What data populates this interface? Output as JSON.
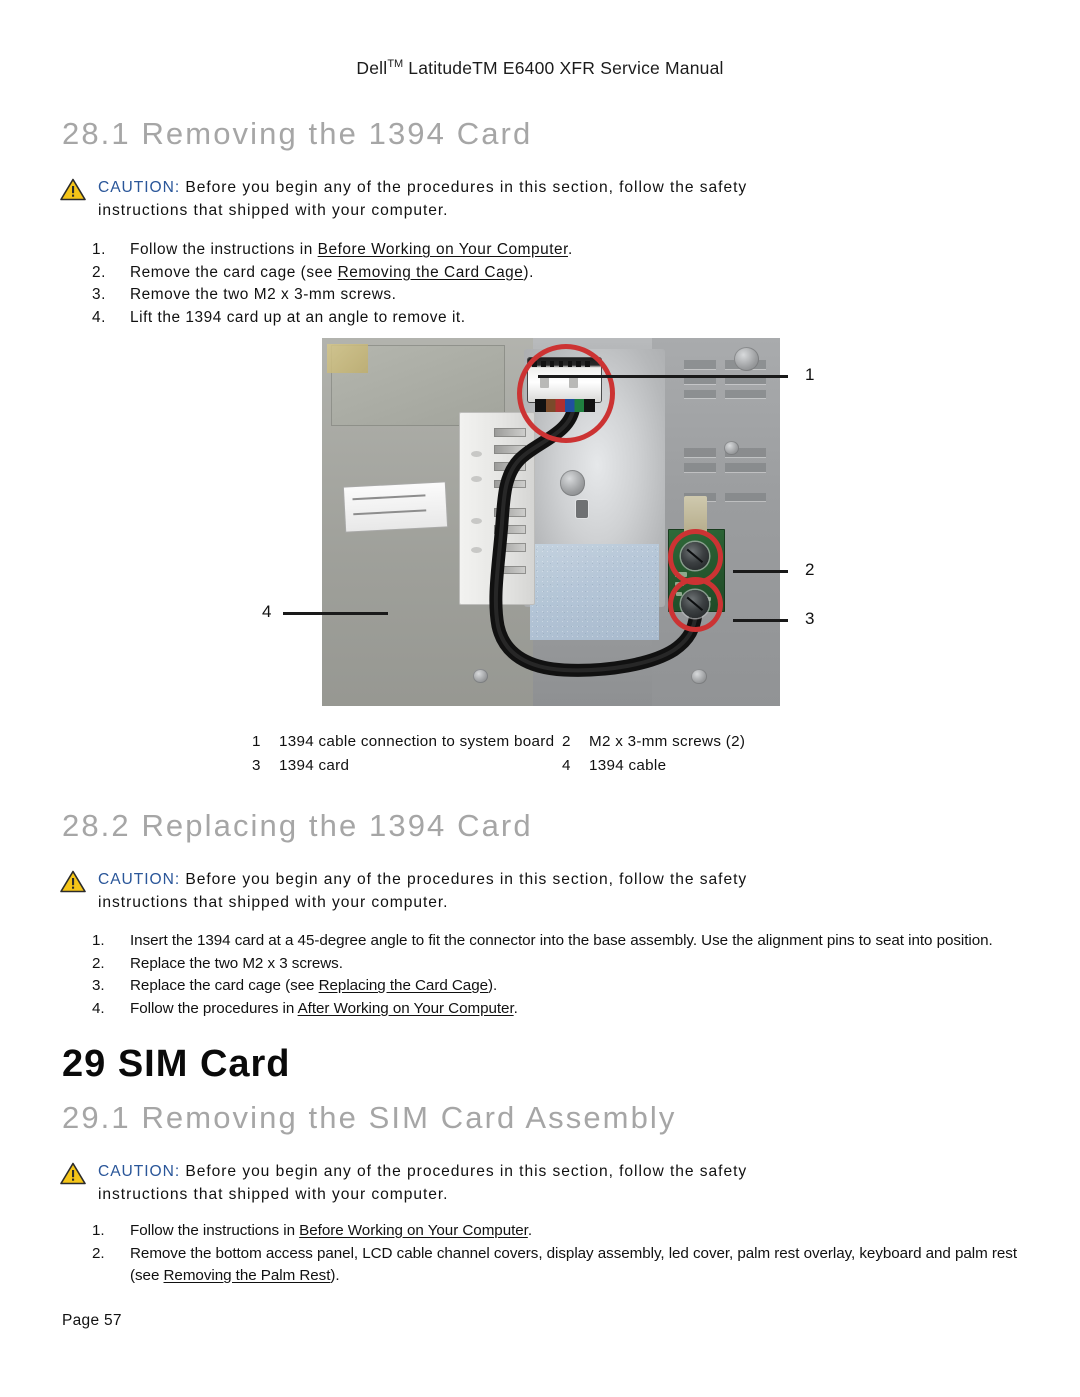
{
  "document": {
    "header_prefix": "Dell",
    "header_tm1": "TM",
    "header_middle": " Latitude",
    "header_tm2": "TM",
    "header_suffix": " E6400 XFR Service Manual",
    "footer": "Page 57"
  },
  "colors": {
    "heading_gray": "#a6a6a6",
    "caution_blue": "#2a5699",
    "warning_yellow": "#f5c518",
    "highlight_red": "#cc3333",
    "body_black": "#111111"
  },
  "caution": {
    "label": "CAUTION:",
    "line1": " Before you begin any of the procedures in this section, follow the safety",
    "line2": "instructions that shipped with your computer.",
    "icon": "warning-triangle-icon"
  },
  "sections": {
    "s28_1": {
      "heading": "28.1  Removing the 1394 Card",
      "steps": [
        {
          "n": "1.",
          "pre": "Follow the instructions in ",
          "link": "Before Working on Your Computer",
          "post": "."
        },
        {
          "n": "2.",
          "pre": "Remove the card cage (see ",
          "link": "Removing the Card Cage",
          "post": ")."
        },
        {
          "n": "3.",
          "pre": "Remove the two M2 x 3-mm screws.",
          "link": "",
          "post": ""
        },
        {
          "n": "4.",
          "pre": "Lift the 1394 card up at an angle to remove it.",
          "link": "",
          "post": ""
        }
      ]
    },
    "s28_2": {
      "heading": "28.2  Replacing the 1394 Card",
      "steps": [
        {
          "n": "1.",
          "pre": "Insert the 1394 card at a 45-degree angle to fit the connector into the base assembly. Use the alignment pins to seat into position.",
          "link": "",
          "post": ""
        },
        {
          "n": "2.",
          "pre": "Replace the two M2 x 3 screws.",
          "link": "",
          "post": ""
        },
        {
          "n": "3.",
          "pre": "Replace the card cage (see ",
          "link": "Replacing the Card Cage",
          "post": ")."
        },
        {
          "n": "4.",
          "pre": "Follow the procedures in ",
          "link": "After Working on Your Computer",
          "post": "."
        }
      ]
    },
    "s29": {
      "heading": "29  SIM Card"
    },
    "s29_1": {
      "heading": "29.1  Removing the SIM Card Assembly",
      "steps": [
        {
          "n": "1.",
          "pre": "Follow the instructions in ",
          "link": "Before Working on Your Computer",
          "post": "."
        },
        {
          "n": "2.",
          "pre": "Remove the bottom access panel, LCD cable channel covers, display assembly, led cover, palm rest overlay, keyboard and palm rest (see ",
          "link": "Removing the Palm Rest",
          "post": ")."
        }
      ]
    }
  },
  "figure": {
    "alt": "1394 card and cable installed in laptop base assembly",
    "callouts": [
      {
        "id": "1",
        "label": "1"
      },
      {
        "id": "2",
        "label": "2"
      },
      {
        "id": "3",
        "label": "3"
      },
      {
        "id": "4",
        "label": "4"
      }
    ],
    "legend": [
      {
        "key": "1",
        "value": "1394 cable connection to system board"
      },
      {
        "key": "2",
        "value": "M2 x 3-mm screws (2)"
      },
      {
        "key": "3",
        "value": "1394 card"
      },
      {
        "key": "4",
        "value": "1394 cable"
      }
    ]
  }
}
